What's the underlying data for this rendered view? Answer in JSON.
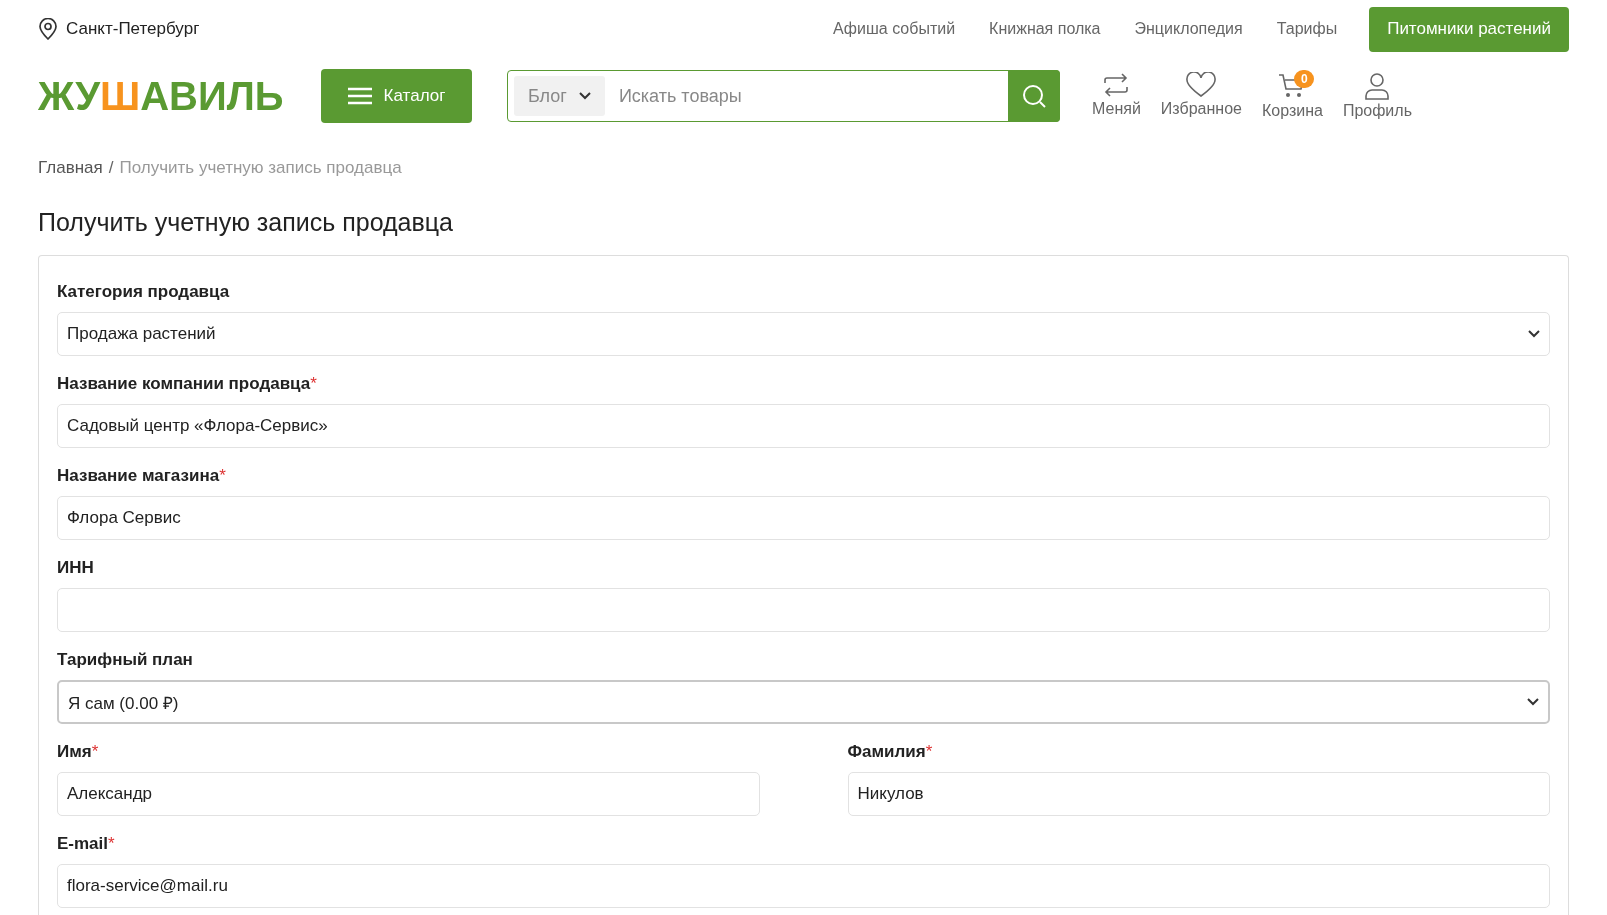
{
  "top_bar": {
    "city": "Санкт-Петербург",
    "links": [
      "Афиша событий",
      "Книжная полка",
      "Энциклопедия",
      "Тарифы"
    ],
    "cta": "Питомники растений"
  },
  "header": {
    "logo": {
      "before": "ЖУ",
      "accent": "Ш",
      "after": "АВИЛЬ"
    },
    "catalog_button": "Каталог",
    "search": {
      "scope": "Блог",
      "placeholder": "Искать товары"
    },
    "actions": [
      {
        "kind": "swap",
        "label": "Меняй"
      },
      {
        "kind": "heart",
        "label": "Избранное"
      },
      {
        "kind": "cart",
        "label": "Корзина",
        "badge": "0"
      },
      {
        "kind": "user",
        "label": "Профиль"
      }
    ]
  },
  "breadcrumb": [
    {
      "label": "Главная",
      "current": false
    },
    {
      "separator": "/",
      "label": "Получить учетную запись продавца",
      "current": true
    }
  ],
  "page_title": "Получить учетную запись продавца",
  "form_rows": [
    [
      {
        "kind": "select",
        "label": "Категория продавца",
        "value": "Продажа растений",
        "focused": false
      }
    ],
    [
      {
        "kind": "text",
        "label": "Название компании продавца",
        "required_mark": "*",
        "value": "Садовый центр «Флора-Сервис»",
        "focused": false
      }
    ],
    [
      {
        "kind": "text",
        "label": "Название магазина",
        "required_mark": "*",
        "value": "Флора Сервис",
        "focused": false
      }
    ],
    [
      {
        "kind": "text",
        "label": "ИНН",
        "focused": false
      }
    ],
    [
      {
        "kind": "select",
        "label": "Тарифный план",
        "value": "Я сам (0.00 ₽)",
        "focused": true
      }
    ],
    [
      {
        "kind": "text",
        "label": "Имя",
        "required_mark": "*",
        "value": "Александр",
        "focused": false
      },
      {
        "kind": "text",
        "label": "Фамилия",
        "required_mark": "*",
        "value": "Никулов",
        "focused": false
      }
    ],
    [
      {
        "kind": "text",
        "label": "E-mail",
        "required_mark": "*",
        "value": "flora-service@mail.ru",
        "focused": false
      }
    ]
  ]
}
